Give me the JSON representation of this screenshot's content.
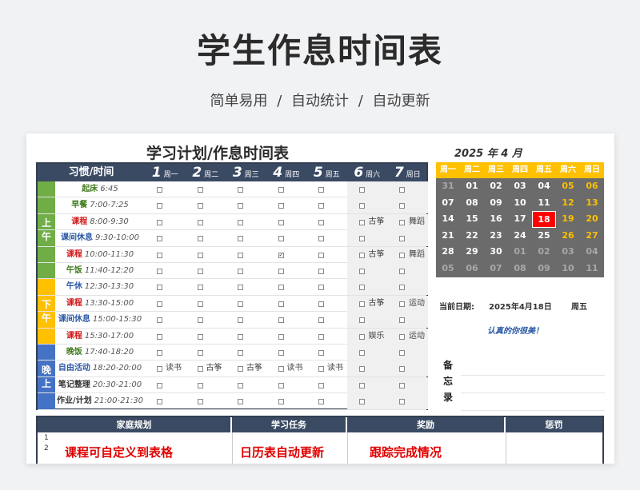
{
  "page": {
    "title": "学生作息时间表",
    "subtitle": "简单易用  /  自动统计  /  自动更新"
  },
  "schedule": {
    "title": "学习计划/作息时间表",
    "habit_header": "习惯/时间",
    "days": [
      {
        "num": "1",
        "label": "周一"
      },
      {
        "num": "2",
        "label": "周二"
      },
      {
        "num": "3",
        "label": "周三"
      },
      {
        "num": "4",
        "label": "周四"
      },
      {
        "num": "5",
        "label": "周五"
      },
      {
        "num": "6",
        "label": "周六"
      },
      {
        "num": "7",
        "label": "周日"
      }
    ],
    "periods": [
      {
        "label": "上午",
        "color": "#70ad47",
        "rows": 6
      },
      {
        "label": "下午",
        "color": "#ffc000",
        "rows": 4
      },
      {
        "label": "晚上",
        "color": "#4472c4",
        "rows": 4
      }
    ],
    "rows": [
      {
        "name": "起床",
        "time": "6:45",
        "color": "green",
        "checks": [
          false,
          false,
          false,
          false,
          false,
          false,
          false
        ],
        "notes": [
          "",
          "",
          "",
          "",
          "",
          "",
          ""
        ]
      },
      {
        "name": "早餐",
        "time": "7:00-7:25",
        "color": "green",
        "checks": [
          false,
          false,
          false,
          false,
          false,
          false,
          false
        ],
        "notes": [
          "",
          "",
          "",
          "",
          "",
          "",
          ""
        ]
      },
      {
        "name": "课程",
        "time": "8:00-9:30",
        "color": "red",
        "checks": [
          false,
          false,
          false,
          false,
          false,
          false,
          false
        ],
        "notes": [
          "",
          "",
          "",
          "",
          "",
          "古筝",
          "舞蹈"
        ]
      },
      {
        "name": "课间休息",
        "time": "9:30-10:00",
        "color": "blue",
        "checks": [
          false,
          false,
          false,
          false,
          false,
          false,
          false
        ],
        "notes": [
          "",
          "",
          "",
          "",
          "",
          "",
          ""
        ]
      },
      {
        "name": "课程",
        "time": "10:00-11:30",
        "color": "red",
        "checks": [
          false,
          false,
          false,
          true,
          false,
          false,
          false
        ],
        "notes": [
          "",
          "",
          "",
          "",
          "",
          "古筝",
          "舞蹈"
        ]
      },
      {
        "name": "午饭",
        "time": "11:40-12:20",
        "color": "green",
        "checks": [
          false,
          false,
          false,
          false,
          false,
          false,
          false
        ],
        "notes": [
          "",
          "",
          "",
          "",
          "",
          "",
          ""
        ]
      },
      {
        "name": "午休",
        "time": "12:30-13:30",
        "color": "blue",
        "checks": [
          false,
          false,
          false,
          false,
          false,
          false,
          false
        ],
        "notes": [
          "",
          "",
          "",
          "",
          "",
          "",
          ""
        ]
      },
      {
        "name": "课程",
        "time": "13:30-15:00",
        "color": "red",
        "checks": [
          false,
          false,
          false,
          false,
          false,
          false,
          false
        ],
        "notes": [
          "",
          "",
          "",
          "",
          "",
          "古筝",
          "运动"
        ]
      },
      {
        "name": "课间休息",
        "time": "15:00-15:30",
        "color": "blue",
        "checks": [
          false,
          false,
          false,
          false,
          false,
          false,
          false
        ],
        "notes": [
          "",
          "",
          "",
          "",
          "",
          "",
          ""
        ]
      },
      {
        "name": "课程",
        "time": "15:30-17:00",
        "color": "red",
        "checks": [
          false,
          false,
          false,
          false,
          false,
          false,
          false
        ],
        "notes": [
          "",
          "",
          "",
          "",
          "",
          "娱乐",
          "运动"
        ]
      },
      {
        "name": "晚饭",
        "time": "17:40-18:20",
        "color": "green",
        "checks": [
          false,
          false,
          false,
          false,
          false,
          false,
          false
        ],
        "notes": [
          "",
          "",
          "",
          "",
          "",
          "",
          ""
        ]
      },
      {
        "name": "自由活动",
        "time": "18:20-20:00",
        "color": "blue",
        "checks": [
          false,
          false,
          false,
          false,
          false,
          false,
          false
        ],
        "notes": [
          "读书",
          "古筝",
          "古筝",
          "读书",
          "读书",
          "",
          ""
        ]
      },
      {
        "name": "笔记整理",
        "time": "20:30-21:00",
        "color": "dark",
        "checks": [
          false,
          false,
          false,
          false,
          false,
          false,
          false
        ],
        "notes": [
          "",
          "",
          "",
          "",
          "",
          "",
          ""
        ]
      },
      {
        "name": "作业/计划",
        "time": "21:00-21:30",
        "color": "dark",
        "checks": [
          false,
          false,
          false,
          false,
          false,
          false,
          false
        ],
        "notes": [
          "",
          "",
          "",
          "",
          "",
          "",
          ""
        ]
      }
    ]
  },
  "calendar": {
    "title": "2025  年      4  月",
    "weekdays": [
      "周一",
      "周二",
      "周三",
      "周四",
      "周五",
      "周六",
      "周日"
    ],
    "weeks": [
      [
        {
          "d": "31",
          "t": "o"
        },
        {
          "d": "01",
          "t": "c"
        },
        {
          "d": "02",
          "t": "c"
        },
        {
          "d": "03",
          "t": "c"
        },
        {
          "d": "04",
          "t": "c"
        },
        {
          "d": "05",
          "t": "w"
        },
        {
          "d": "06",
          "t": "w"
        }
      ],
      [
        {
          "d": "07",
          "t": "c"
        },
        {
          "d": "08",
          "t": "c"
        },
        {
          "d": "09",
          "t": "c"
        },
        {
          "d": "10",
          "t": "c"
        },
        {
          "d": "11",
          "t": "c"
        },
        {
          "d": "12",
          "t": "w"
        },
        {
          "d": "13",
          "t": "w"
        }
      ],
      [
        {
          "d": "14",
          "t": "c"
        },
        {
          "d": "15",
          "t": "c"
        },
        {
          "d": "16",
          "t": "c"
        },
        {
          "d": "17",
          "t": "c"
        },
        {
          "d": "18",
          "t": "today"
        },
        {
          "d": "19",
          "t": "w"
        },
        {
          "d": "20",
          "t": "w"
        }
      ],
      [
        {
          "d": "21",
          "t": "c"
        },
        {
          "d": "22",
          "t": "c"
        },
        {
          "d": "23",
          "t": "c"
        },
        {
          "d": "24",
          "t": "c"
        },
        {
          "d": "25",
          "t": "c"
        },
        {
          "d": "26",
          "t": "w"
        },
        {
          "d": "27",
          "t": "w"
        }
      ],
      [
        {
          "d": "28",
          "t": "c"
        },
        {
          "d": "29",
          "t": "c"
        },
        {
          "d": "30",
          "t": "c"
        },
        {
          "d": "01",
          "t": "o"
        },
        {
          "d": "02",
          "t": "o"
        },
        {
          "d": "03",
          "t": "o"
        },
        {
          "d": "04",
          "t": "o"
        }
      ],
      [
        {
          "d": "05",
          "t": "o"
        },
        {
          "d": "06",
          "t": "o"
        },
        {
          "d": "07",
          "t": "o"
        },
        {
          "d": "08",
          "t": "o"
        },
        {
          "d": "09",
          "t": "o"
        },
        {
          "d": "10",
          "t": "o"
        },
        {
          "d": "11",
          "t": "o"
        }
      ]
    ],
    "current_date_label": "当前日期:",
    "current_date": "2025年4月18日",
    "current_weekday": "周五",
    "motto": "认真的你很美！",
    "memo_label": "备忘录"
  },
  "bottom": {
    "headers": [
      "家庭规划",
      "学习任务",
      "奖励",
      "惩罚"
    ],
    "row_numbers": [
      "1",
      "2"
    ],
    "highlights": [
      "课程可自定义到表格",
      "日历表自动更新",
      "跟踪完成情况"
    ]
  }
}
